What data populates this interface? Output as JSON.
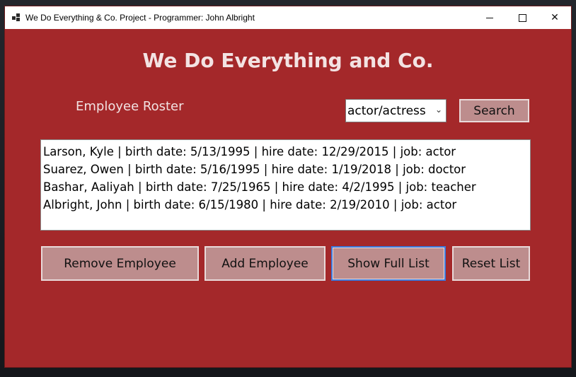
{
  "window": {
    "title": "We Do Everything & Co. Project - Programmer: John Albright",
    "controls": {
      "minimize": "minimize",
      "maximize": "maximize",
      "close": "✕"
    }
  },
  "header": {
    "title": "We Do Everything and Co.",
    "roster_label": "Employee Roster"
  },
  "filter": {
    "selected": "actor/actress",
    "search_label": "Search"
  },
  "employees": [
    "Larson, Kyle | birth date: 5/13/1995 | hire date: 12/29/2015 | job: actor",
    "Suarez, Owen | birth date: 5/16/1995 | hire date: 1/19/2018 | job: doctor",
    "Bashar, Aaliyah | birth date: 7/25/1965 | hire date: 4/2/1995 | job: teacher",
    "Albright, John | birth date: 6/15/1980 | hire date: 2/19/2010 | job: actor"
  ],
  "actions": {
    "remove": "Remove Employee",
    "add": "Add Employee",
    "show_full": "Show Full List",
    "reset": "Reset List"
  },
  "colors": {
    "form_background": "#a4282a",
    "button_background": "#bd8d8d",
    "focus_border": "#3b7be0"
  }
}
